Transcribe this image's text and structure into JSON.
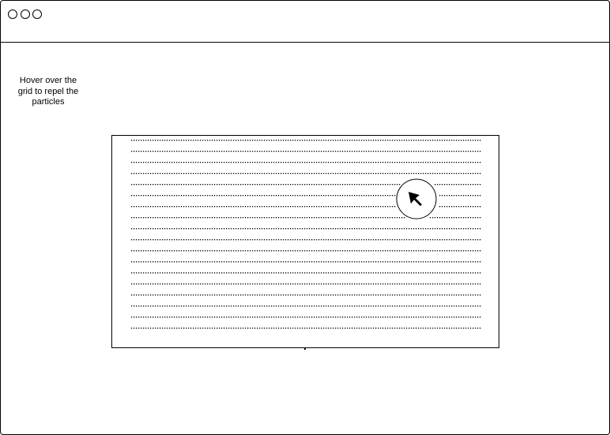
{
  "window": {
    "controls": [
      "close",
      "minimize",
      "maximize"
    ]
  },
  "hint": {
    "line1": "Hover over the",
    "line2": "grid to repel the",
    "line3": "particles"
  },
  "particle_grid": {
    "rows": 18,
    "dots_per_row": 148,
    "cursor_icon": "arrow-cursor-icon",
    "repel_ring_icon": "repel-radius-ring"
  }
}
